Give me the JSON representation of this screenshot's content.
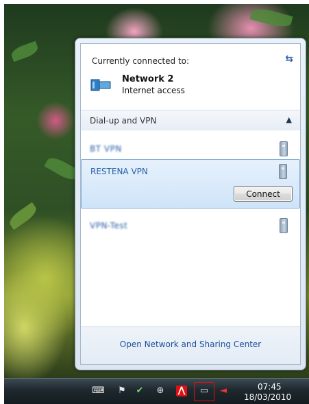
{
  "flyout": {
    "connected_heading": "Currently connected to:",
    "network": {
      "name": "Network  2",
      "status": "Internet access"
    },
    "section": {
      "label": "Dial-up and VPN"
    },
    "vpn_items": [
      {
        "label": "BT VPN",
        "blurred": true
      },
      {
        "label": "RESTENA VPN",
        "blurred": false,
        "selected": true
      },
      {
        "label": "VPN-Test",
        "blurred": true
      }
    ],
    "connect_label": "Connect",
    "footer_link": "Open Network and Sharing Center"
  },
  "taskbar": {
    "time": "07:45",
    "date": "18/03/2010",
    "tray_icons": [
      "keyboard-icon",
      "action-center-flag-icon",
      "safely-remove-hardware-icon",
      "network-adapter-icon",
      "antivirus-icon",
      "network-icon",
      "volume-muted-icon"
    ]
  },
  "colors": {
    "link": "#1c4f9c",
    "vpn_label": "#2a5fa7",
    "selection_border": "#84acd6",
    "taskbar": "#1e282e",
    "highlight_box": "#dd1111"
  }
}
